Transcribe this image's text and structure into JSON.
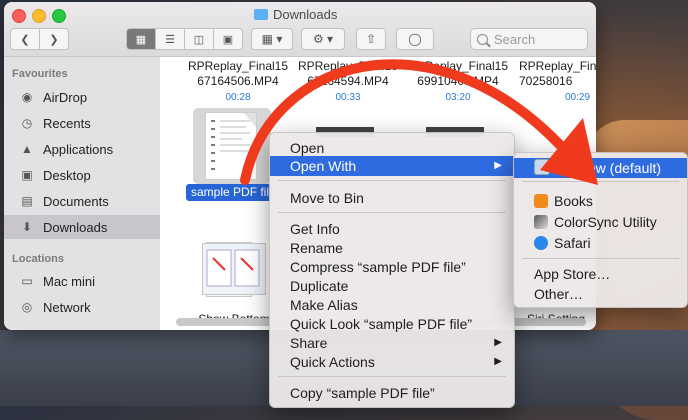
{
  "window": {
    "title": "Downloads"
  },
  "toolbar": {
    "search_placeholder": "Search"
  },
  "sidebar": {
    "favourites_heading": "Favourites",
    "favourites": [
      {
        "label": "AirDrop",
        "icon": "airdrop-icon"
      },
      {
        "label": "Recents",
        "icon": "clock-icon"
      },
      {
        "label": "Applications",
        "icon": "applications-icon"
      },
      {
        "label": "Desktop",
        "icon": "desktop-icon"
      },
      {
        "label": "Documents",
        "icon": "document-icon"
      },
      {
        "label": "Downloads",
        "icon": "download-icon",
        "selected": true
      }
    ],
    "locations_heading": "Locations",
    "locations": [
      {
        "label": "Mac mini",
        "icon": "computer-icon"
      },
      {
        "label": "Network",
        "icon": "globe-icon"
      }
    ]
  },
  "files": {
    "row1": [
      {
        "line1": "RPReplay_Final15",
        "line2": "67164506.MP4",
        "duration": "00:28"
      },
      {
        "line1": "RPReplay_Final15",
        "line2": "67164594.MP4",
        "duration": "00:33"
      },
      {
        "line1": "RPReplay_Final15",
        "line2": "69910405.MP4",
        "duration": "03:20"
      },
      {
        "line1": "RPReplay_Final15",
        "line2": "70258016",
        "duration": "00:29"
      }
    ],
    "selected_label": "sample PDF file",
    "row3_left": "Show Bottom",
    "row3_right": "Siri Setting"
  },
  "context_menu": {
    "items": [
      "Open",
      "Open With",
      "Move to Bin",
      "Get Info",
      "Rename",
      "Compress “sample PDF file”",
      "Duplicate",
      "Make Alias",
      "Quick Look “sample PDF file”",
      "Share",
      "Quick Actions",
      "Copy “sample PDF file”"
    ],
    "highlighted_index": 1
  },
  "submenu": {
    "items": [
      "Preview (default)",
      "Books",
      "ColorSync Utility",
      "Safari",
      "App Store…",
      "Other…"
    ],
    "highlighted_index": 0
  },
  "colors": {
    "accent": "#2e6be0",
    "arrow": "#f03a1e"
  }
}
